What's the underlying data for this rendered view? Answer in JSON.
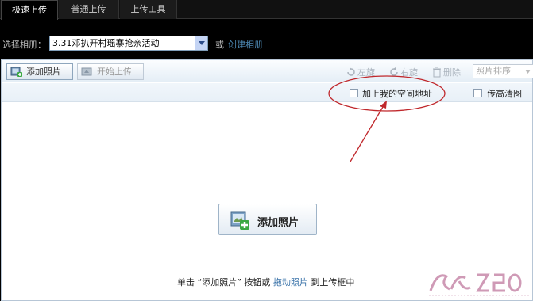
{
  "tabs": [
    {
      "label": "极速上传",
      "active": true
    },
    {
      "label": "普通上传",
      "active": false
    },
    {
      "label": "上传工具",
      "active": false
    }
  ],
  "album": {
    "label": "选择相册：",
    "selected": "3.31邓扒开村瑶寨抢亲活动",
    "or_text": "或",
    "create_link": "创建相册"
  },
  "toolbar": {
    "add_label": "添加照片",
    "start_label": "开始上传",
    "rotate_left": "左旋",
    "rotate_right": "右旋",
    "delete": "删除",
    "sort_placeholder": "照片排序"
  },
  "options": {
    "add_space_address": "加上我的空间地址",
    "hd_upload": "传高清图"
  },
  "dropzone": {
    "add_button": "添加照片",
    "hint_prefix": "单击 “添加照片” 按钮或 ",
    "hint_link": "拖动照片",
    "hint_suffix": " 到上传框中"
  },
  "colors": {
    "accent_link": "#4e8ab5",
    "annotation_red": "#c0282c",
    "plus_green": "#3aa842"
  }
}
